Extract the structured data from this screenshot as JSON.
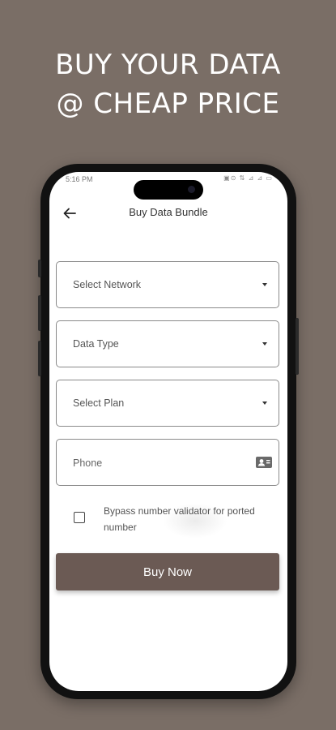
{
  "promo": {
    "line1": "BUY YOUR DATA",
    "line2": "@ CHEAP PRICE"
  },
  "status_bar": {
    "time": "5:16 PM",
    "icons": "▣⊙ ⇅ ⊿ ⊿ ▭"
  },
  "appbar": {
    "back_icon": "arrow-left",
    "title": "Buy Data Bundle"
  },
  "form": {
    "network": {
      "label": "Select Network"
    },
    "data_type": {
      "label": "Data Type"
    },
    "plan": {
      "label": "Select Plan"
    },
    "phone": {
      "placeholder": "Phone",
      "value": "",
      "icon": "contact-card"
    },
    "bypass": {
      "checked": false,
      "label": "Bypass number validator for ported number"
    },
    "buy_label": "Buy Now"
  },
  "colors": {
    "background": "#7a6e66",
    "button": "#6b5a54",
    "text": "#555555"
  }
}
